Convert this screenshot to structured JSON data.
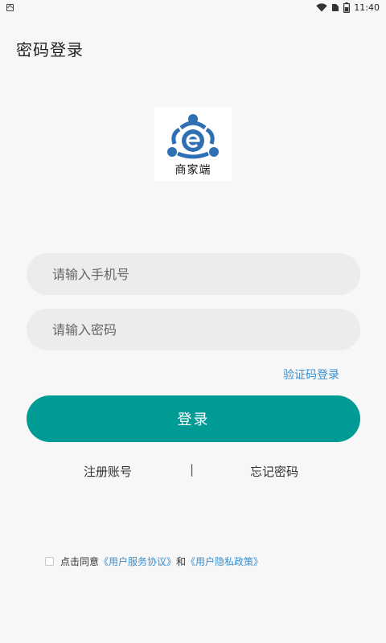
{
  "status_bar": {
    "time": "11:40",
    "icons": [
      "notification-icon",
      "wifi-icon",
      "sim-icon",
      "battery-icon"
    ]
  },
  "header": {
    "title": "密码登录"
  },
  "logo": {
    "caption": "商家端",
    "colors": {
      "blue": "#2f6fb3",
      "white": "#ffffff"
    }
  },
  "form": {
    "phone_placeholder": "请输入手机号",
    "password_placeholder": "请输入密码",
    "sms_login_link": "验证码登录",
    "login_button": "登录"
  },
  "links": {
    "register": "注册账号",
    "divider": "|",
    "forgot": "忘记密码"
  },
  "agreement": {
    "prefix": "点击同意",
    "user_agreement": "《用户服务协议》",
    "and": "和",
    "privacy_policy": "《用户隐私政策》",
    "checked": false
  },
  "colors": {
    "primary": "#009b94",
    "link": "#3b8fcf",
    "background": "#f7f7f7",
    "input_bg": "#ececec"
  }
}
